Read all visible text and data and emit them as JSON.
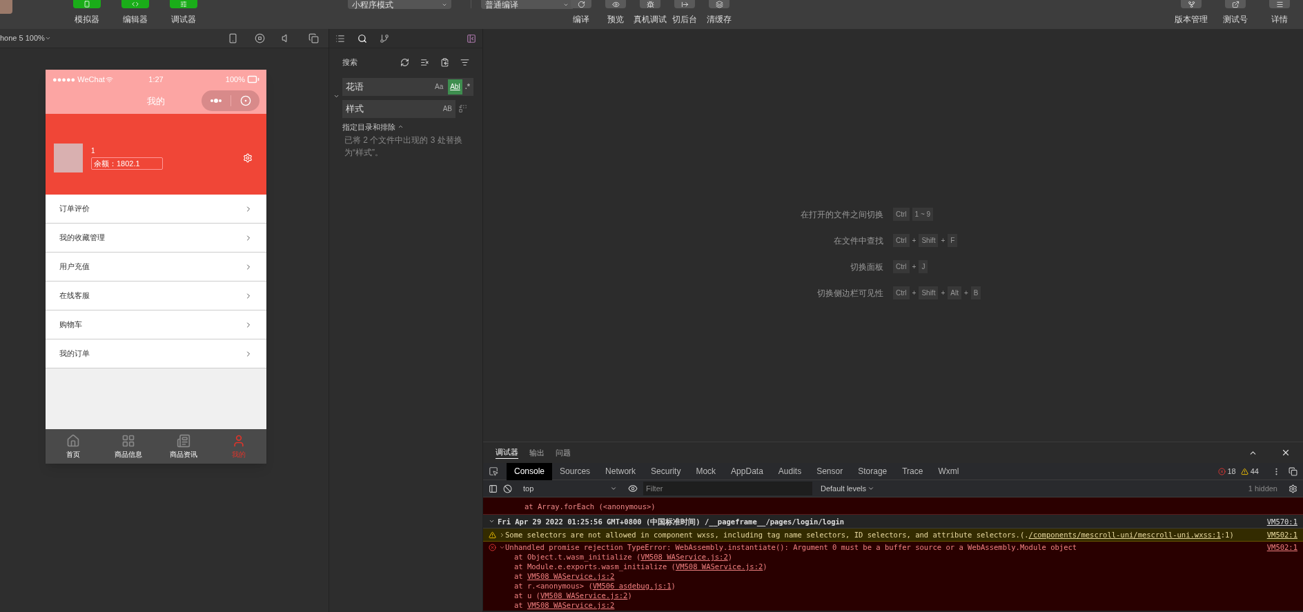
{
  "toolbar": {
    "views": [
      {
        "label": "模拟器",
        "selected": true
      },
      {
        "label": "编辑器",
        "selected": true
      },
      {
        "label": "调试器",
        "selected": true
      }
    ],
    "mode_select": "小程序模式",
    "compile_select": "普通编译",
    "actions": [
      {
        "label": "编译",
        "kind": "compile"
      },
      {
        "label": "预览",
        "kind": "preview"
      },
      {
        "label": "真机调试",
        "kind": "device"
      },
      {
        "label": "切后台",
        "kind": "background"
      },
      {
        "label": "清缓存",
        "kind": "cache"
      }
    ],
    "right_actions": [
      {
        "label": "版本管理",
        "kind": "version"
      },
      {
        "label": "测试号",
        "kind": "test"
      },
      {
        "label": "详情",
        "kind": "details"
      }
    ]
  },
  "simulator": {
    "device": "hone 5 100%",
    "phone": {
      "carrier": "●●●●● WeChat",
      "time": "1:27",
      "battery": "100%",
      "title": "我的",
      "user_name": "1",
      "balance": "余额：1802.1",
      "menu": [
        "订单评价",
        "我的收藏管理",
        "用户充值",
        "在线客服",
        "购物车",
        "我的订单"
      ],
      "tabs": [
        {
          "label": "首页",
          "selected": false,
          "kind": "home"
        },
        {
          "label": "商品信息",
          "selected": false,
          "kind": "grid"
        },
        {
          "label": "商品资讯",
          "selected": false,
          "kind": "news"
        },
        {
          "label": "我的",
          "selected": true,
          "kind": "user"
        }
      ]
    }
  },
  "search": {
    "title": "搜索",
    "find": "花语",
    "replace": "样式",
    "options": [
      {
        "label": "Aa",
        "selected": false
      },
      {
        "label": "Abl",
        "selected": true
      }
    ],
    "regex": ".*",
    "preserve_case": "AB",
    "include_label": "指定目录和排除",
    "result": "已将 2 个文件中出现的 3 处替换为“样式”。"
  },
  "shortcuts": [
    {
      "label": "在打开的文件之间切换",
      "keys": [
        {
          "kind": "key",
          "text": "Ctrl"
        },
        {
          "kind": "key",
          "text": "1 ~ 9"
        }
      ]
    },
    {
      "label": "在文件中查找",
      "keys": [
        {
          "kind": "key",
          "text": "Ctrl"
        },
        {
          "kind": "plus",
          "text": "+"
        },
        {
          "kind": "key",
          "text": "Shift"
        },
        {
          "kind": "plus",
          "text": "+"
        },
        {
          "kind": "key",
          "text": "F"
        }
      ]
    },
    {
      "label": "切换面板",
      "keys": [
        {
          "kind": "key",
          "text": "Ctrl"
        },
        {
          "kind": "plus",
          "text": "+"
        },
        {
          "kind": "key",
          "text": "J"
        }
      ]
    },
    {
      "label": "切换侧边栏可见性",
      "keys": [
        {
          "kind": "key",
          "text": "Ctrl"
        },
        {
          "kind": "plus",
          "text": "+"
        },
        {
          "kind": "key",
          "text": "Shift"
        },
        {
          "kind": "plus",
          "text": "+"
        },
        {
          "kind": "key",
          "text": "Alt"
        },
        {
          "kind": "plus",
          "text": "+"
        },
        {
          "kind": "key",
          "text": "B"
        }
      ]
    }
  ],
  "console": {
    "panel_tabs": [
      {
        "label": "调试器",
        "selected": true
      },
      {
        "label": "输出",
        "selected": false
      },
      {
        "label": "问题",
        "selected": false
      }
    ],
    "tabs": [
      {
        "label": "Console",
        "selected": true
      },
      {
        "label": "Sources",
        "selected": false
      },
      {
        "label": "Network",
        "selected": false
      },
      {
        "label": "Security",
        "selected": false
      },
      {
        "label": "Mock",
        "selected": false
      },
      {
        "label": "AppData",
        "selected": false
      },
      {
        "label": "Audits",
        "selected": false
      },
      {
        "label": "Sensor",
        "selected": false
      },
      {
        "label": "Storage",
        "selected": false
      },
      {
        "label": "Trace",
        "selected": false
      },
      {
        "label": "Wxml",
        "selected": false
      }
    ],
    "errors": "18",
    "warnings": "44",
    "context": "top",
    "filter_placeholder": "Filter",
    "levels": "Default levels",
    "hidden": "1 hidden",
    "entries": [
      {
        "kind": "stack_tail",
        "text": "at Array.forEach (<anonymous>)"
      },
      {
        "kind": "group",
        "text": "Fri Apr 29 2022 01:25:56 GMT+0800 (中国标准时间) /__pageframe__/pages/login/login",
        "source": "VM570:1"
      },
      {
        "kind": "warning",
        "text": "Some selectors are not allowed in component wxss, including tag name selectors, ID selectors, and attribute selectors.(.",
        "link": "/components/mescroll-uni/mescroll-uni.wxss:1",
        "suffix": ":1)",
        "source": "VM502:1"
      },
      {
        "kind": "error",
        "text": "Unhandled promise rejection TypeError: WebAssembly.instantiate(): Argument 0 must be a buffer source or a WebAssembly.Module object",
        "source": "VM502:1",
        "stack": [
          {
            "prefix": "at Object.t.wasm_initialize (",
            "link": "VM508 WAService.js:2",
            "suffix": ")"
          },
          {
            "prefix": "at Module.e.exports.wasm_initialize (",
            "link": "VM508 WAService.js:2",
            "suffix": ")"
          },
          {
            "prefix": "at ",
            "link": "VM508 WAService.js:2"
          },
          {
            "prefix": "at r.<anonymous> (",
            "link": "VM506 asdebug.js:1",
            "suffix": ")"
          },
          {
            "prefix": "at u (",
            "link": "VM508 WAService.js:2",
            "suffix": ")"
          },
          {
            "prefix": "at ",
            "link": "VM508 WAService.js:2"
          }
        ]
      }
    ]
  }
}
